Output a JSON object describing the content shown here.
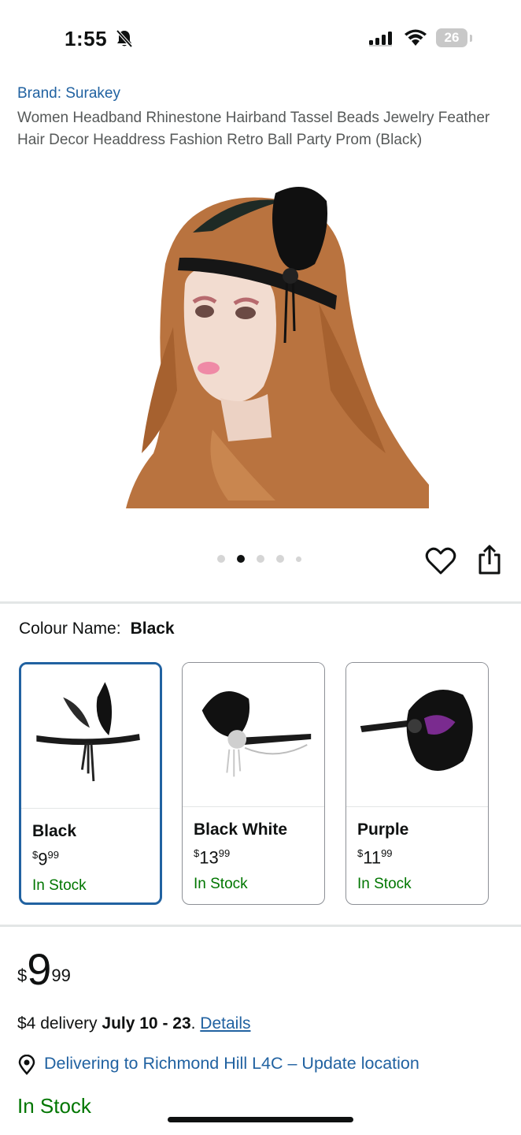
{
  "status_bar": {
    "time": "1:55",
    "battery": "26"
  },
  "product": {
    "brand": "Brand: Surakey",
    "title": "Women Headband Rhinestone Hairband Tassel Beads Jewelry Feather Hair Decor Headdress Fashion Retro Ball Party Prom (Black)",
    "image_count": 5,
    "active_image_index": 1
  },
  "colour": {
    "label": "Colour Name:",
    "value": "Black"
  },
  "variants": [
    {
      "name": "Black",
      "price_currency": "$",
      "price_whole": "9",
      "price_fraction": "99",
      "stock": "In Stock",
      "selected": true
    },
    {
      "name": "Black White",
      "price_currency": "$",
      "price_whole": "13",
      "price_fraction": "99",
      "stock": "In Stock",
      "selected": false
    },
    {
      "name": "Purple",
      "price_currency": "$",
      "price_whole": "11",
      "price_fraction": "99",
      "stock": "In Stock",
      "selected": false
    }
  ],
  "buybox": {
    "price_currency": "$",
    "price_whole": "9",
    "price_fraction": "99",
    "delivery_prefix": "$4 delivery ",
    "delivery_dates": "July 10 - 23",
    "delivery_sep": ". ",
    "details_link": "Details",
    "location_text": "Delivering to Richmond Hill L4C – Update location",
    "stock": "In Stock"
  },
  "icons": {
    "bell": "bell-slash-icon",
    "signal": "cellular-signal-icon",
    "wifi": "wifi-icon",
    "heart": "heart-icon",
    "share": "share-icon",
    "location": "location-pin-icon"
  },
  "colors": {
    "link": "#2162a1",
    "in_stock": "#007600",
    "selected_border": "#2162a1"
  }
}
